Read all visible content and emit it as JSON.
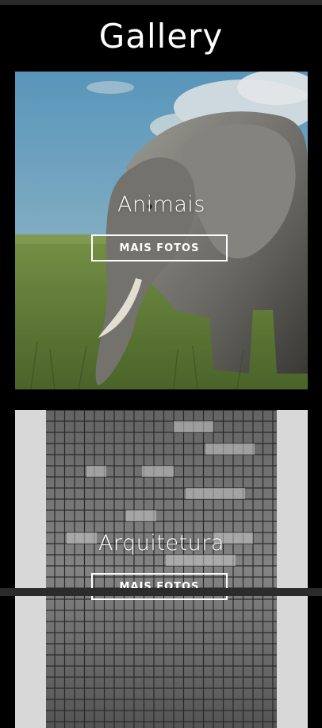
{
  "page": {
    "title": "Gallery"
  },
  "cards": [
    {
      "label": "Animais",
      "button": "MAIS FOTOS",
      "image": "elephant-photo"
    },
    {
      "label": "Arquitetura",
      "button": "MAIS FOTOS",
      "image": "building-facade-photo"
    }
  ]
}
